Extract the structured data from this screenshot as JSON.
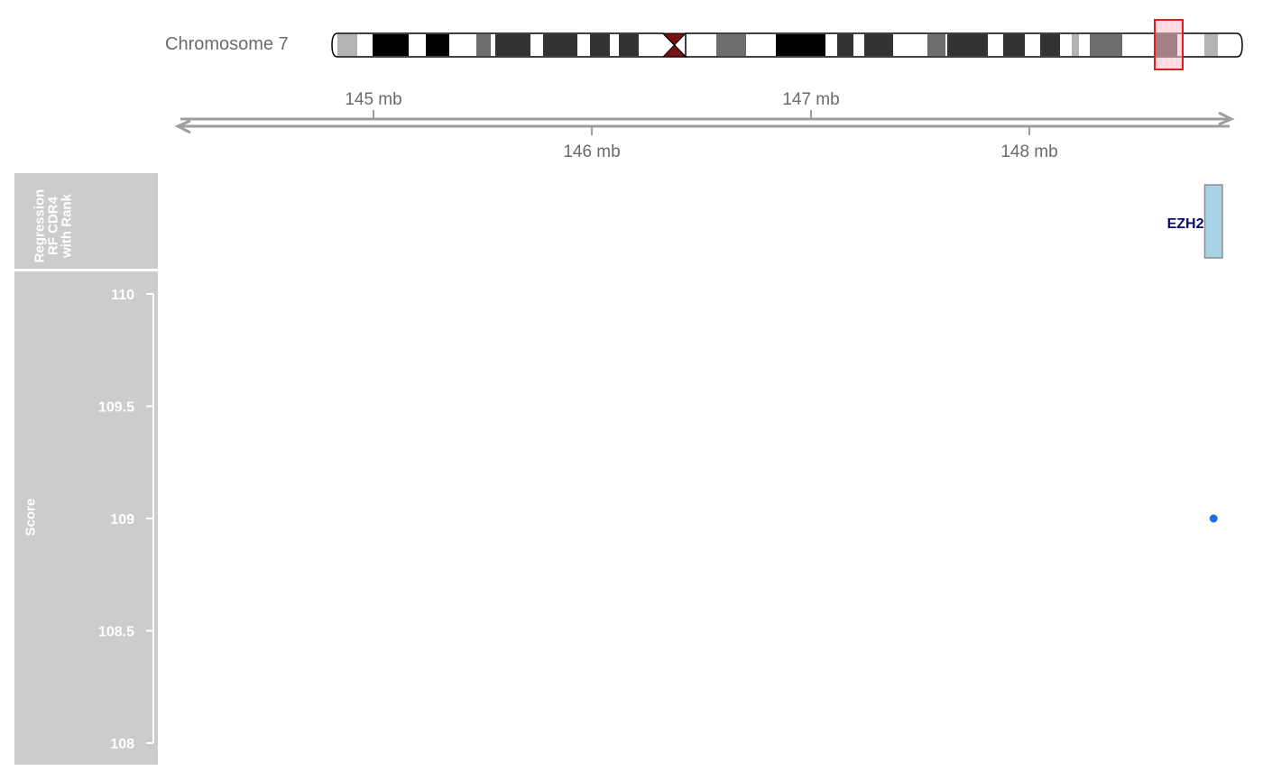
{
  "ideogram": {
    "label": "Chromosome 7",
    "colors": {
      "outline": "#000000",
      "centromere": "#7a1212",
      "highlight_stroke": "#e31a1c",
      "highlight_fill": "#ffc0cb"
    }
  },
  "axis": {
    "color": "#9e9e9e",
    "top_ticks": [
      "145 mb",
      "147 mb"
    ],
    "bottom_ticks": [
      "146 mb",
      "148 mb"
    ],
    "tick_values_mb": [
      145,
      146,
      147,
      148
    ]
  },
  "tracks": {
    "gene_track_title": [
      "Regression",
      "RF CDR4",
      "with Rank"
    ],
    "score_track_title": "Score",
    "panel_color": "#cccccc"
  },
  "chart_data": {
    "type": "scatter",
    "title": "",
    "xlabel": "",
    "ylabel": "Score",
    "xlim_mb": [
      144.1,
      148.9
    ],
    "ylim": [
      108,
      110
    ],
    "y_ticks": [
      "110",
      "109.5",
      "109",
      "108.5",
      "108"
    ],
    "y_tick_values": [
      110,
      109.5,
      109,
      108.5,
      108
    ],
    "points": [
      {
        "x_mb": 148.84,
        "y": 109,
        "color": "#1f6fe5"
      }
    ],
    "genes": [
      {
        "name": "EZH2",
        "start_mb": 148.8,
        "end_mb": 148.88,
        "fill": "#a6d4e6",
        "label_color": "#0a0a6e"
      }
    ],
    "grid": false,
    "legend": "none"
  }
}
